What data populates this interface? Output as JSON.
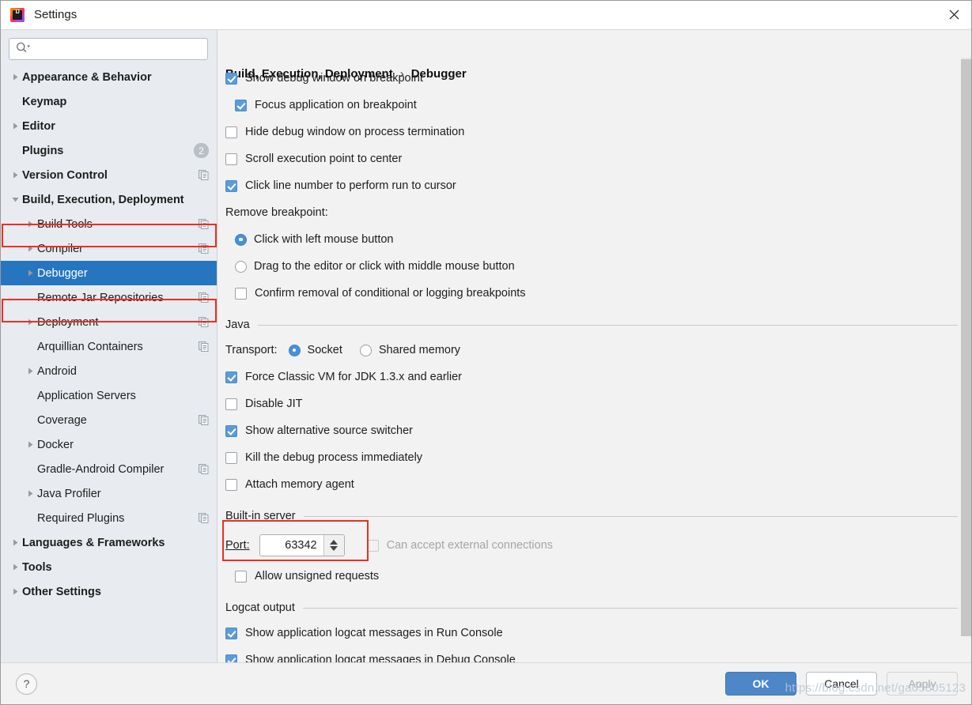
{
  "window": {
    "title": "Settings",
    "app_icon": "intellij-idea-icon",
    "close_icon": "close-icon"
  },
  "colors": {
    "accent_blue": "#2675bf",
    "checkbox_blue": "#5b9bd9",
    "radio_blue": "#4a90d9",
    "annotation_red": "#ef2d22",
    "sidebar_bg": "#e8ecf0",
    "content_bg": "#f2f2f2",
    "primary_button": "#4d87c7"
  },
  "search": {
    "value": "",
    "placeholder": "",
    "icon": "search-icon"
  },
  "sidebar": {
    "items": [
      {
        "label": "Appearance & Behavior",
        "level": 0,
        "bold": true,
        "arrow": "collapsed",
        "badge": null,
        "copy_icon": false,
        "selected": false
      },
      {
        "label": "Keymap",
        "level": 0,
        "bold": true,
        "arrow": "none",
        "badge": null,
        "copy_icon": false,
        "selected": false
      },
      {
        "label": "Editor",
        "level": 0,
        "bold": true,
        "arrow": "collapsed",
        "badge": null,
        "copy_icon": false,
        "selected": false
      },
      {
        "label": "Plugins",
        "level": 0,
        "bold": true,
        "arrow": "none",
        "badge": "2",
        "copy_icon": false,
        "selected": false
      },
      {
        "label": "Version Control",
        "level": 0,
        "bold": true,
        "arrow": "collapsed",
        "badge": null,
        "copy_icon": true,
        "selected": false
      },
      {
        "label": "Build, Execution, Deployment",
        "level": 0,
        "bold": true,
        "arrow": "expanded",
        "badge": null,
        "copy_icon": false,
        "selected": false,
        "highlighted": true
      },
      {
        "label": "Build Tools",
        "level": 1,
        "bold": false,
        "arrow": "collapsed",
        "badge": null,
        "copy_icon": true,
        "selected": false
      },
      {
        "label": "Compiler",
        "level": 1,
        "bold": false,
        "arrow": "collapsed",
        "badge": null,
        "copy_icon": true,
        "selected": false
      },
      {
        "label": "Debugger",
        "level": 1,
        "bold": false,
        "arrow": "collapsed",
        "badge": null,
        "copy_icon": false,
        "selected": true,
        "highlighted": true
      },
      {
        "label": "Remote Jar Repositories",
        "level": 1,
        "bold": false,
        "arrow": "none",
        "badge": null,
        "copy_icon": true,
        "selected": false
      },
      {
        "label": "Deployment",
        "level": 1,
        "bold": false,
        "arrow": "collapsed",
        "badge": null,
        "copy_icon": true,
        "selected": false
      },
      {
        "label": "Arquillian Containers",
        "level": 1,
        "bold": false,
        "arrow": "none",
        "badge": null,
        "copy_icon": true,
        "selected": false
      },
      {
        "label": "Android",
        "level": 1,
        "bold": false,
        "arrow": "collapsed",
        "badge": null,
        "copy_icon": false,
        "selected": false
      },
      {
        "label": "Application Servers",
        "level": 1,
        "bold": false,
        "arrow": "none",
        "badge": null,
        "copy_icon": false,
        "selected": false
      },
      {
        "label": "Coverage",
        "level": 1,
        "bold": false,
        "arrow": "none",
        "badge": null,
        "copy_icon": true,
        "selected": false
      },
      {
        "label": "Docker",
        "level": 1,
        "bold": false,
        "arrow": "collapsed",
        "badge": null,
        "copy_icon": false,
        "selected": false
      },
      {
        "label": "Gradle-Android Compiler",
        "level": 1,
        "bold": false,
        "arrow": "none",
        "badge": null,
        "copy_icon": true,
        "selected": false
      },
      {
        "label": "Java Profiler",
        "level": 1,
        "bold": false,
        "arrow": "collapsed",
        "badge": null,
        "copy_icon": false,
        "selected": false
      },
      {
        "label": "Required Plugins",
        "level": 1,
        "bold": false,
        "arrow": "none",
        "badge": null,
        "copy_icon": true,
        "selected": false
      },
      {
        "label": "Languages & Frameworks",
        "level": 0,
        "bold": true,
        "arrow": "collapsed",
        "badge": null,
        "copy_icon": false,
        "selected": false
      },
      {
        "label": "Tools",
        "level": 0,
        "bold": true,
        "arrow": "collapsed",
        "badge": null,
        "copy_icon": false,
        "selected": false
      },
      {
        "label": "Other Settings",
        "level": 0,
        "bold": true,
        "arrow": "collapsed",
        "badge": null,
        "copy_icon": false,
        "selected": false
      }
    ]
  },
  "breadcrumb": {
    "root": "Build, Execution, Deployment",
    "separator": "›",
    "leaf": "Debugger"
  },
  "main": {
    "top_checkboxes": [
      {
        "label": "Show debug window on breakpoint",
        "checked": true,
        "indent": 0
      },
      {
        "label": "Focus application on breakpoint",
        "checked": true,
        "indent": 1
      },
      {
        "label": "Hide debug window on process termination",
        "checked": false,
        "indent": 0
      },
      {
        "label": "Scroll execution point to center",
        "checked": false,
        "indent": 0
      },
      {
        "label": "Click line number to perform run to cursor",
        "checked": true,
        "indent": 0
      }
    ],
    "remove_breakpoint_label": "Remove breakpoint:",
    "remove_breakpoint_options": [
      {
        "label": "Click with left mouse button",
        "selected": true
      },
      {
        "label": "Drag to the editor or click with middle mouse button",
        "selected": false
      }
    ],
    "confirm_removal": {
      "label": "Confirm removal of conditional or logging breakpoints",
      "checked": false
    },
    "java_group": {
      "title": "Java",
      "transport_label": "Transport:",
      "transport_options": [
        {
          "label": "Socket",
          "selected": true
        },
        {
          "label": "Shared memory",
          "selected": false
        }
      ],
      "checkboxes": [
        {
          "label": "Force Classic VM for JDK 1.3.x and earlier",
          "checked": true
        },
        {
          "label": "Disable JIT",
          "checked": false
        },
        {
          "label": "Show alternative source switcher",
          "checked": true
        },
        {
          "label": "Kill the debug process immediately",
          "checked": false
        },
        {
          "label": "Attach memory agent",
          "checked": false
        }
      ]
    },
    "builtin_server_group": {
      "title": "Built-in server",
      "port_label": "Port:",
      "port_value": "63342",
      "can_accept_external": {
        "label": "Can accept external connections",
        "checked": false,
        "disabled": true
      },
      "allow_unsigned": {
        "label": "Allow unsigned requests",
        "checked": false
      }
    },
    "logcat_group": {
      "title": "Logcat output",
      "checkboxes": [
        {
          "label": "Show application logcat messages in Run Console",
          "checked": true
        },
        {
          "label": "Show application logcat messages in Debug Console",
          "checked": true
        }
      ]
    }
  },
  "footer": {
    "help_label": "?",
    "ok_label": "OK",
    "cancel_label": "Cancel",
    "apply_label": "Apply"
  },
  "watermark": "https://blog.csdn.net/ga05805123"
}
